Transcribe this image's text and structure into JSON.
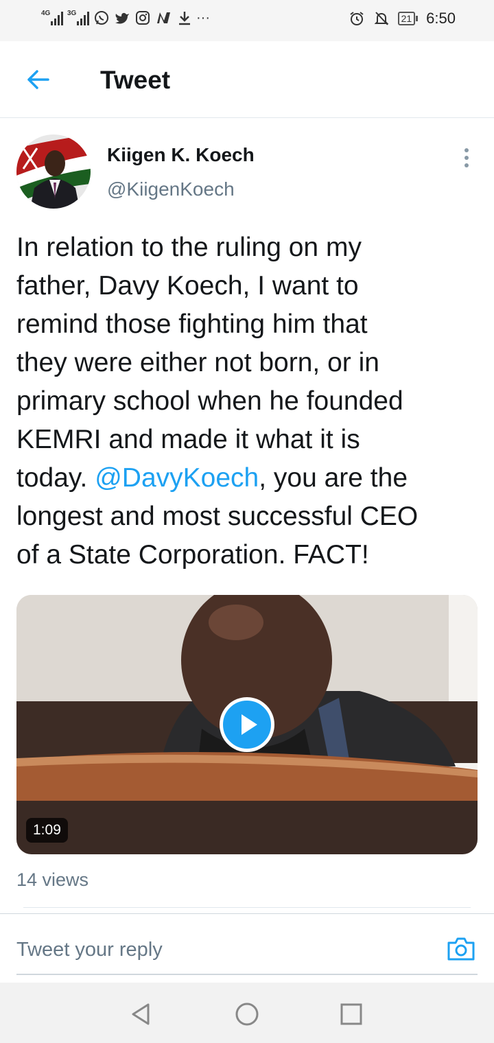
{
  "status_bar": {
    "network_1": "4G",
    "network_2": "3G",
    "notification_icons": [
      "whatsapp-icon",
      "twitter-icon",
      "instagram-icon",
      "n-app-icon",
      "download-icon",
      "more-notifications-icon"
    ],
    "more_glyph": "···",
    "battery_level": "21",
    "time": "6:50"
  },
  "header": {
    "title": "Tweet"
  },
  "tweet": {
    "author_name": "Kiigen K. Koech",
    "author_handle": "@KiigenKoech",
    "text_before": "In relation to the ruling on my\nfather, Davy Koech, I want to\nremind those fighting him that\nthey were either not born, or in\nprimary school when he founded\nKEMRI and made it what it is\ntoday. ",
    "mention": "@DavyKoech",
    "text_after": ", you are the\nlongest and most successful CEO\nof a State Corporation. FACT!",
    "video_duration": "1:09",
    "views": "14 views"
  },
  "reply": {
    "placeholder": "Tweet your reply"
  },
  "colors": {
    "accent": "#1da1f2",
    "secondary_text": "#657786",
    "primary_text": "#14171a"
  }
}
